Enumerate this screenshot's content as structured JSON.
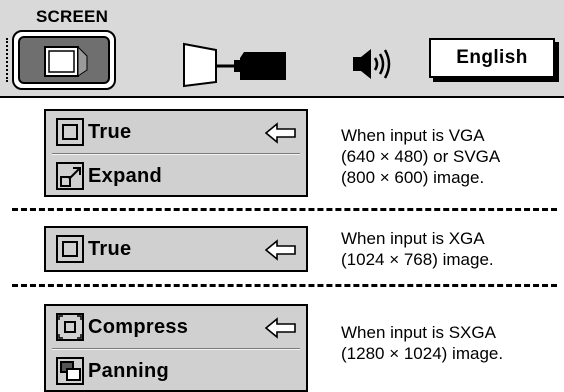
{
  "menu": {
    "title": "SCREEN",
    "language_button": "English",
    "icons": [
      "screen-icon",
      "projector-icon",
      "speaker-icon"
    ]
  },
  "sections": [
    {
      "options": [
        {
          "label": "True",
          "icon": "true-icon",
          "selected": true
        },
        {
          "label": "Expand",
          "icon": "expand-icon",
          "selected": false
        }
      ],
      "description": [
        "When input is VGA",
        "(640 × 480) or SVGA",
        "(800 × 600) image."
      ]
    },
    {
      "options": [
        {
          "label": "True",
          "icon": "true-icon",
          "selected": true
        }
      ],
      "description": [
        "When input is XGA",
        "(1024 × 768) image."
      ]
    },
    {
      "options": [
        {
          "label": "Compress",
          "icon": "compress-icon",
          "selected": true
        },
        {
          "label": "Panning",
          "icon": "panning-icon",
          "selected": false
        }
      ],
      "description": [
        "When input is SXGA",
        "(1280 × 1024) image."
      ]
    }
  ],
  "colors": {
    "menu_bg": "#d9d9d9",
    "panel_bg": "#d0d0d0",
    "selected_button": "#6f6f6f"
  }
}
